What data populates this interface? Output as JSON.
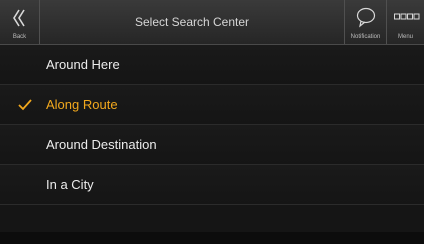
{
  "header": {
    "title": "Select Search Center",
    "back_label": "Back",
    "notification_label": "Notification",
    "menu_label": "Menu"
  },
  "items": [
    {
      "label": "Around Here",
      "selected": false
    },
    {
      "label": "Along Route",
      "selected": true
    },
    {
      "label": "Around Destination",
      "selected": false
    },
    {
      "label": "In a City",
      "selected": false
    }
  ],
  "colors": {
    "selected_accent": "#f2a81d"
  },
  "icons": {
    "back": "double-chevron-left-icon",
    "notification": "speech-bubble-icon",
    "menu": "grid-icon",
    "selected": "checkmark-icon"
  }
}
